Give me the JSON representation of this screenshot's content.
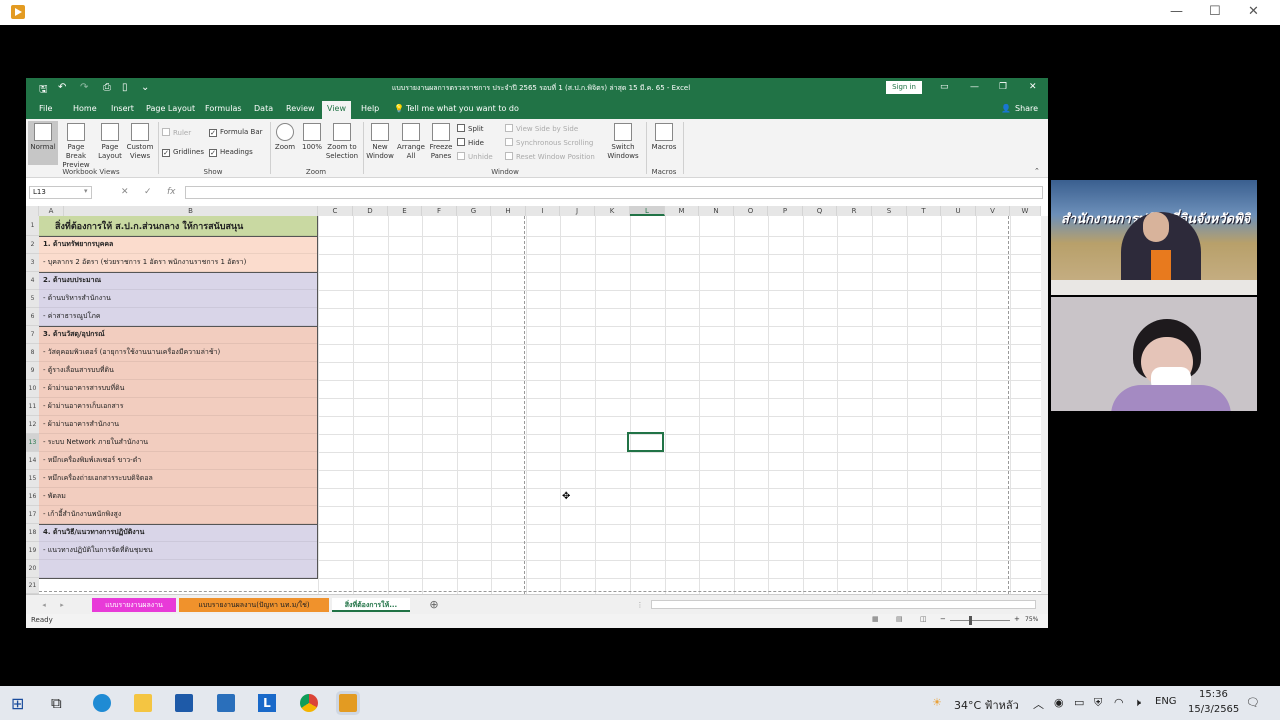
{
  "window": {
    "minimize": "—",
    "maximize": "☐",
    "close": "✕"
  },
  "excel": {
    "title": "แบบรายงานผลการตรวจราชการ ประจำปี 2565 รอบที่ 1 (ส.ป.ก.พิจิตร) ล่าสุด 15 มี.ค. 65  -  Excel",
    "signin": "Sign in",
    "share": "Share",
    "tell_me": "Tell me what you want to do",
    "menu": [
      "File",
      "Home",
      "Insert",
      "Page Layout",
      "Formulas",
      "Data",
      "Review",
      "View",
      "Help"
    ],
    "ribbon": {
      "normal": "Normal",
      "page_break": "Page Break Preview",
      "page_layout": "Page Layout",
      "custom_views": "Custom Views",
      "ruler": "Ruler",
      "formula_bar": "Formula Bar",
      "gridlines": "Gridlines",
      "headings": "Headings",
      "zoom": "Zoom",
      "zoom100": "100%",
      "zoom_sel": "Zoom to Selection",
      "new_window": "New Window",
      "arrange_all": "Arrange All",
      "freeze_panes": "Freeze Panes",
      "split": "Split",
      "hide": "Hide",
      "unhide": "Unhide",
      "side_by_side": "View Side by Side",
      "sync_scroll": "Synchronous Scrolling",
      "reset_pos": "Reset Window Position",
      "switch_windows": "Switch Windows",
      "macros": "Macros",
      "grp_workbook": "Workbook Views",
      "grp_show": "Show",
      "grp_zoom": "Zoom",
      "grp_window": "Window",
      "grp_macros": "Macros"
    },
    "namebox": "L13",
    "columns": [
      "A",
      "B",
      "C",
      "D",
      "E",
      "F",
      "G",
      "H",
      "I",
      "J",
      "K",
      "L",
      "M",
      "N",
      "O",
      "P",
      "Q",
      "R",
      "S",
      "T",
      "U",
      "V",
      "W"
    ],
    "rows": [
      "1",
      "2",
      "3",
      "4",
      "5",
      "6",
      "7",
      "8",
      "9",
      "10",
      "11",
      "12",
      "13",
      "14",
      "15",
      "16",
      "17",
      "18",
      "19",
      "20",
      "21"
    ],
    "cells": [
      "สิ่งที่ต้องการให้ ส.ป.ก.ส่วนกลาง ให้การสนับสนุน",
      "1. ด้านทรัพยากรบุคคล",
      "   - บุคลากร 2 อัตรา (ช่วยราชการ 1 อัตรา  พนักงานราชการ 1 อัตรา)",
      "2. ด้านงบประมาณ",
      "   - ด้านบริหารสำนักงาน",
      "   - ค่าสาธารณูปโภค",
      "3. ด้านวัสดุ/อุปกรณ์",
      "   - วัสดุคอมพิวเตอร์ (อายุการใช้งานนานเครื่องมีความล่าช้า)",
      "   - ตู้รางเลื่อนสารบบที่ดิน",
      "   - ผ้าม่านอาคารสารบบที่ดิน",
      "   - ผ้าม่านอาคารเก็บเอกสาร",
      "   - ผ้าม่านอาคารสำนักงาน",
      "   -  ระบบ Network ภายในสำนักงาน",
      "   -  หมึกเครื่องพิมพ์เลเซอร์ ขาว-ดำ",
      "   -  หมึกเครื่องถ่ายเอกสารระบบดิจิตอล",
      "   -  พัดลม",
      "   -  เก้าอี้สำนักงานพนักพิงสูง",
      "4. ด้านวิธี/แนวทางการปฏิบัติงาน",
      "   - แนวทางปฏิบัติในการจัดที่ดินชุมชน",
      "",
      ""
    ],
    "tabs": [
      "แบบรายงานผลงาน",
      "แบบรายงานผลงาน(ปัญหา นท.ม/ใช่)",
      "สิ่งที่ต้องการให้..."
    ],
    "status": "Ready",
    "zoom": "75%",
    "colors": {
      "green": "#217346",
      "row1": "#c9d9a2",
      "block1": "#fbdccd",
      "block2": "#d9d5e8",
      "block3": "#f2cdbf",
      "tab1": "#e83ad8",
      "tab2": "#f0922c"
    }
  },
  "taskbar": {
    "weather": "34°C  ฟ้าหลัว",
    "lang": "ENG",
    "time": "15:36",
    "date": "15/3/2565"
  }
}
